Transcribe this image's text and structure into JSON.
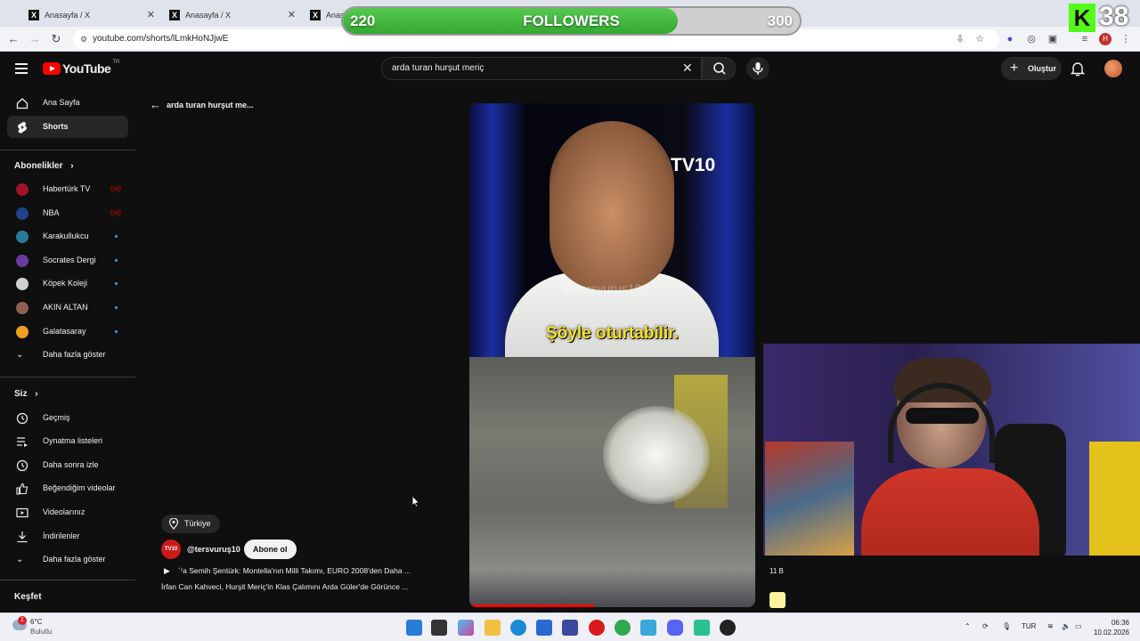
{
  "browser": {
    "tabs": [
      {
        "title": "Anasayfa / X"
      },
      {
        "title": "Anasayfa / X"
      },
      {
        "title": "Anas"
      }
    ],
    "url": "youtube.com/shorts/lLmkHoNJjwE"
  },
  "overlay": {
    "followers_current": "220",
    "followers_label": "FOLLOWERS",
    "followers_goal": "300",
    "progress_fraction": 0.733,
    "kick_count": "38",
    "kick_letter": "K"
  },
  "header": {
    "logo_text": "YouTube",
    "region": "TR",
    "search_value": "arda turan hurşut meriç",
    "create_label": "Oluştur"
  },
  "sidebar": {
    "main": [
      {
        "label": "Ana Sayfa"
      },
      {
        "label": "Shorts"
      }
    ],
    "subscriptions_title": "Abonelikler",
    "subscriptions": [
      {
        "label": "Habertürk TV",
        "color": "#a0122a"
      },
      {
        "label": "NBA",
        "color": "#1d428a"
      },
      {
        "label": "Karakullukcu",
        "color": "#2a7a9a"
      },
      {
        "label": "Socrates Dergi",
        "color": "#6a3aa0"
      },
      {
        "label": "Köpek Koleji",
        "color": "#d0d0d0"
      },
      {
        "label": "AKIN ALTAN",
        "color": "#8a6050"
      },
      {
        "label": "Galatasaray",
        "color": "#f0a020"
      }
    ],
    "show_more": "Daha fazla göster",
    "you_title": "Siz",
    "you_items": [
      {
        "label": "Geçmiş"
      },
      {
        "label": "Oynatma listeleri"
      },
      {
        "label": "Daha sonra izle"
      },
      {
        "label": "Beğendiğim videolar"
      },
      {
        "label": "Videolarınız"
      },
      {
        "label": "İndirilenler"
      },
      {
        "label": "Daha fazla göster"
      }
    ],
    "explore_title": "Keşfet"
  },
  "main": {
    "back_title": "arda turan hurşut me...",
    "video_logo": "TV10",
    "video_watermark": "@tersvurus10",
    "video_subtitle": "Şöyle oturtabilir.",
    "location": "Türkiye",
    "channel_handle": "@tersvuruş10",
    "channel_avatar_text": "TV10",
    "subscribe_label": "Abone ol",
    "music_text": "´ʳa Semih Şentürk: Montella'nın Milli Takımı, EURO 2008'den Daha ...",
    "title_text": "İrfan Can Kahveci, Hurşit Meriç'in Klas Çalımını Arda Güler'de Görünce ...",
    "views": "11 B"
  },
  "taskbar": {
    "temperature": "6°C",
    "weather": "Bulutlu",
    "weather_badge": "1",
    "language": "TUR",
    "time": "06:36",
    "date": "10.02.2026"
  }
}
